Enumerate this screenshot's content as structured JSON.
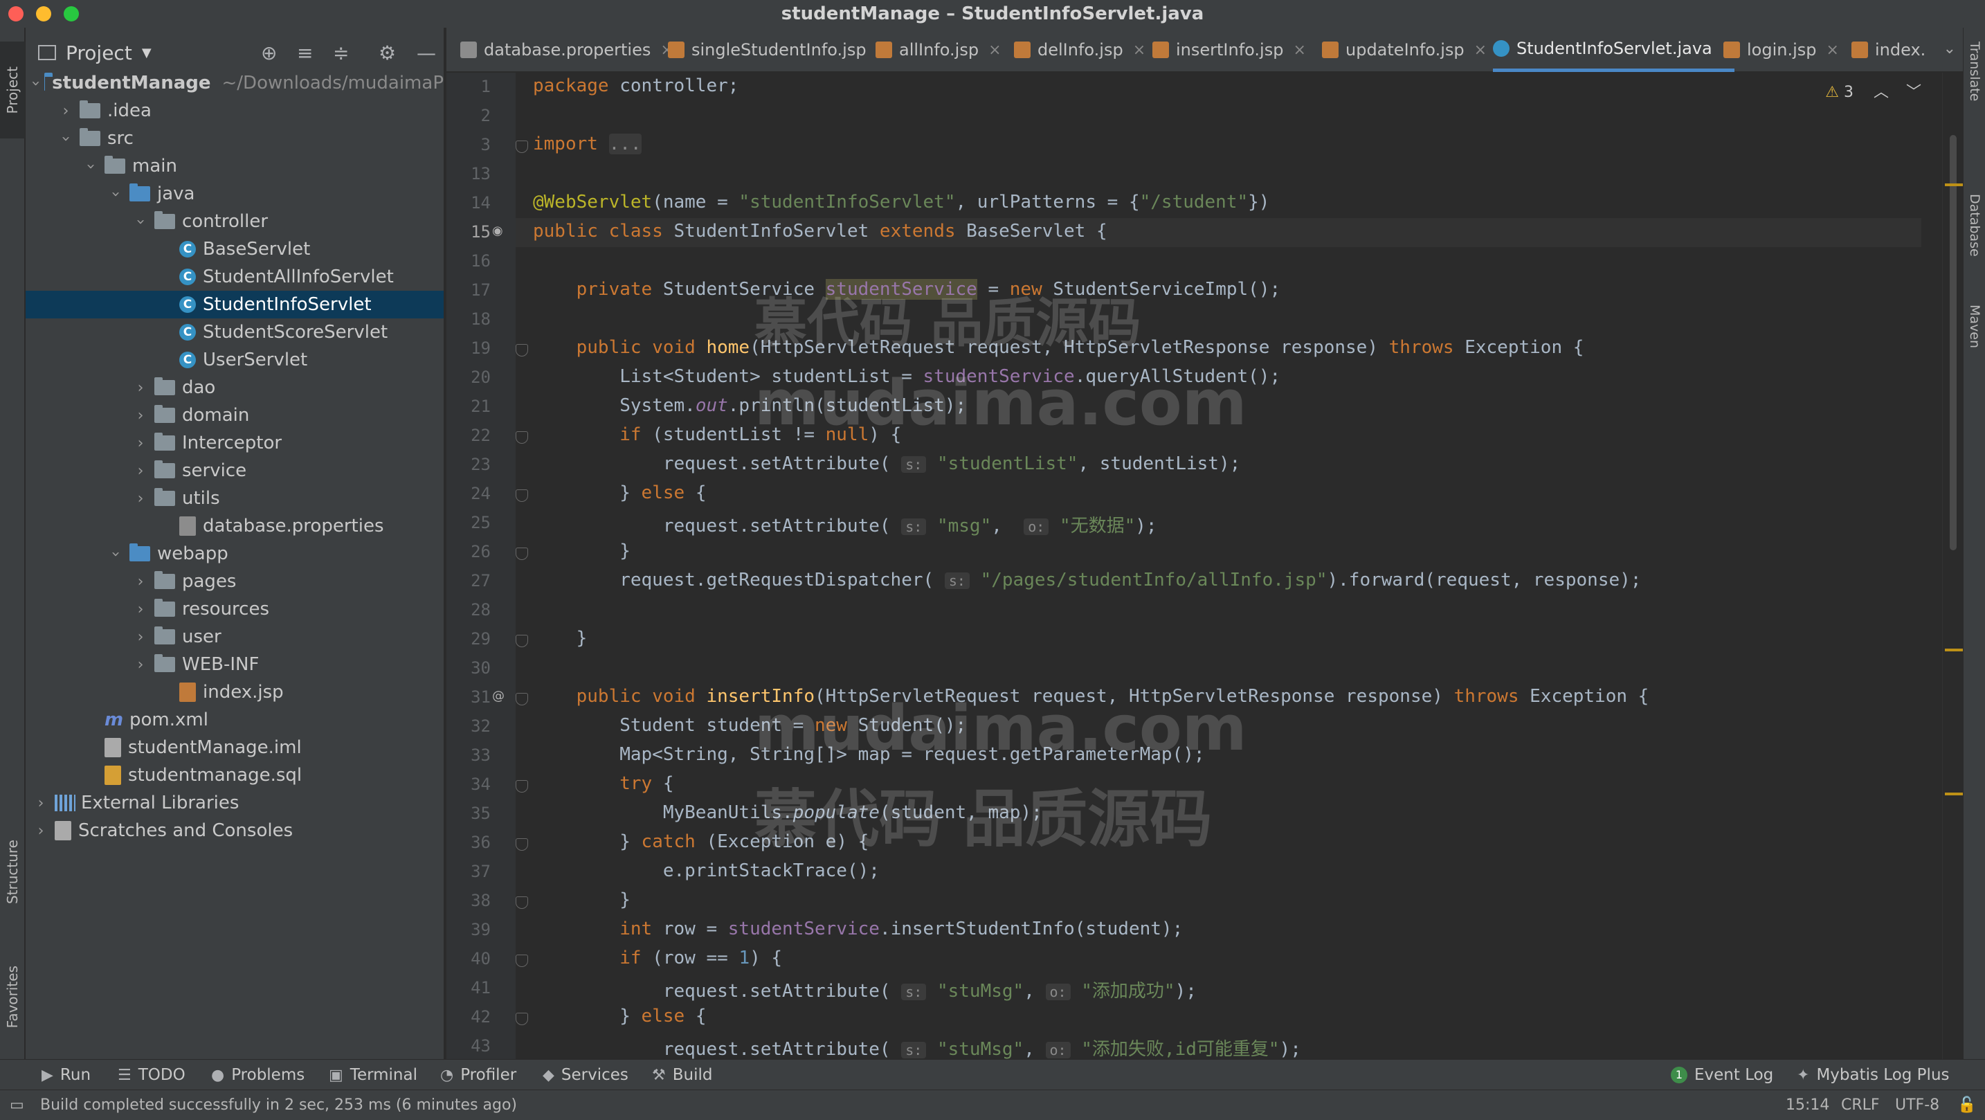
{
  "window": {
    "title": "studentManage – StudentInfoServlet.java",
    "traffic_colors": [
      "#fe5f57",
      "#febc2e",
      "#28c840"
    ]
  },
  "left_strip": {
    "project_label": "Project",
    "structure_label": "Structure",
    "favorites_label": "Favorites"
  },
  "right_strip": {
    "translate_label": "Translate",
    "database_label": "Database",
    "maven_label": "Maven"
  },
  "project_panel": {
    "title": "Project",
    "tree": [
      {
        "label": "studentManage",
        "extra": "~/Downloads/mudaimaP",
        "depth": 0,
        "expanded": true,
        "icon": "module-folder-icon",
        "bold": true
      },
      {
        "label": ".idea",
        "depth": 1,
        "expanded": false,
        "icon": "folder-icon"
      },
      {
        "label": "src",
        "depth": 1,
        "expanded": true,
        "icon": "folder-icon"
      },
      {
        "label": "main",
        "depth": 2,
        "expanded": true,
        "icon": "folder-icon"
      },
      {
        "label": "java",
        "depth": 3,
        "expanded": true,
        "icon": "source-folder-icon"
      },
      {
        "label": "controller",
        "depth": 4,
        "expanded": true,
        "icon": "package-icon"
      },
      {
        "label": "BaseServlet",
        "depth": 5,
        "icon": "class-icon"
      },
      {
        "label": "StudentAllInfoServlet",
        "depth": 5,
        "icon": "class-icon"
      },
      {
        "label": "StudentInfoServlet",
        "depth": 5,
        "icon": "class-icon",
        "selected": true
      },
      {
        "label": "StudentScoreServlet",
        "depth": 5,
        "icon": "class-icon"
      },
      {
        "label": "UserServlet",
        "depth": 5,
        "icon": "class-icon"
      },
      {
        "label": "dao",
        "depth": 4,
        "expanded": false,
        "icon": "package-icon"
      },
      {
        "label": "domain",
        "depth": 4,
        "expanded": false,
        "icon": "package-icon"
      },
      {
        "label": "Interceptor",
        "depth": 4,
        "expanded": false,
        "icon": "package-icon"
      },
      {
        "label": "service",
        "depth": 4,
        "expanded": false,
        "icon": "package-icon"
      },
      {
        "label": "utils",
        "depth": 4,
        "expanded": false,
        "icon": "package-icon"
      },
      {
        "label": "database.properties",
        "depth": 5,
        "icon": "properties-file-icon"
      },
      {
        "label": "webapp",
        "depth": 3,
        "expanded": true,
        "icon": "web-folder-icon"
      },
      {
        "label": "pages",
        "depth": 4,
        "expanded": false,
        "icon": "folder-icon"
      },
      {
        "label": "resources",
        "depth": 4,
        "expanded": false,
        "icon": "folder-icon"
      },
      {
        "label": "user",
        "depth": 4,
        "expanded": false,
        "icon": "folder-icon"
      },
      {
        "label": "WEB-INF",
        "depth": 4,
        "expanded": false,
        "icon": "folder-icon"
      },
      {
        "label": "index.jsp",
        "depth": 5,
        "icon": "jsp-file-icon"
      },
      {
        "label": "pom.xml",
        "depth": 2,
        "icon": "maven-icon"
      },
      {
        "label": "studentManage.iml",
        "depth": 2,
        "icon": "iml-file-icon"
      },
      {
        "label": "studentmanage.sql",
        "depth": 2,
        "icon": "sql-file-icon"
      },
      {
        "label": "External Libraries",
        "depth": 0,
        "expanded": false,
        "icon": "library-icon"
      },
      {
        "label": "Scratches and Consoles",
        "depth": 0,
        "expanded": false,
        "icon": "scratches-icon"
      }
    ]
  },
  "tabs": [
    {
      "label": "database.properties",
      "icon": "properties-file-icon"
    },
    {
      "label": "singleStudentInfo.jsp",
      "icon": "jsp-file-icon"
    },
    {
      "label": "allInfo.jsp",
      "icon": "jsp-file-icon"
    },
    {
      "label": "delInfo.jsp",
      "icon": "jsp-file-icon"
    },
    {
      "label": "insertInfo.jsp",
      "icon": "jsp-file-icon"
    },
    {
      "label": "updateInfo.jsp",
      "icon": "jsp-file-icon"
    },
    {
      "label": "StudentInfoServlet.java",
      "icon": "class-icon",
      "active": true
    },
    {
      "label": "login.jsp",
      "icon": "jsp-file-icon"
    },
    {
      "label": "index.",
      "icon": "jsp-file-icon"
    }
  ],
  "editor": {
    "warning_count": "3",
    "current_line": "15",
    "lines": [
      {
        "n": "1",
        "html": "<span class='kw'>package</span> controller;"
      },
      {
        "n": "2",
        "html": ""
      },
      {
        "n": "3",
        "html": "<span class='kw'>import</span> <span class='fold'>...</span>"
      },
      {
        "n": "13",
        "html": ""
      },
      {
        "n": "14",
        "html": "<span class='ann'>@WebServlet</span>(name = <span class='str'>\"studentInfoServlet\"</span>, urlPatterns = {<span class='str'>\"/student\"</span>})"
      },
      {
        "n": "15",
        "html": "<span class='kw'>public class</span> StudentInfoServlet <span class='kw'>extends</span> BaseServlet {"
      },
      {
        "n": "16",
        "html": ""
      },
      {
        "n": "17",
        "html": "    <span class='kw'>private</span> StudentService <span class='fld hl'>studentService</span> = <span class='kw'>new</span> StudentServiceImpl();"
      },
      {
        "n": "18",
        "html": ""
      },
      {
        "n": "19",
        "html": "    <span class='kw'>public void</span> <span class='fn'>home</span>(HttpServletRequest request, HttpServletResponse response) <span class='kw'>throws</span> Exception {"
      },
      {
        "n": "20",
        "html": "        List&lt;Student&gt; studentList = <span class='fld'>studentService</span>.queryAllStudent();"
      },
      {
        "n": "21",
        "html": "        System.<span class='fld italic'>out</span>.println(studentList);"
      },
      {
        "n": "22",
        "html": "        <span class='kw'>if</span> (studentList != <span class='kw'>null</span>) {"
      },
      {
        "n": "23",
        "html": "            request.setAttribute( <span class='hint'>s:</span> <span class='str'>\"studentList\"</span>, studentList);"
      },
      {
        "n": "24",
        "html": "        } <span class='kw'>else</span> {"
      },
      {
        "n": "25",
        "html": "            request.setAttribute( <span class='hint'>s:</span> <span class='str'>\"msg\"</span>,  <span class='hint'>o:</span> <span class='str'>\"无数据\"</span>);"
      },
      {
        "n": "26",
        "html": "        }"
      },
      {
        "n": "27",
        "html": "        request.getRequestDispatcher( <span class='hint'>s:</span> <span class='str'>\"/pages/studentInfo/allInfo.jsp\"</span>).forward(request, response);"
      },
      {
        "n": "28",
        "html": ""
      },
      {
        "n": "29",
        "html": "    }"
      },
      {
        "n": "30",
        "html": ""
      },
      {
        "n": "31",
        "html": "    <span class='kw'>public void</span> <span class='fn'>insertInfo</span>(HttpServletRequest request, HttpServletResponse response) <span class='kw'>throws</span> Exception {"
      },
      {
        "n": "32",
        "html": "        Student student = <span class='kw'>new</span> Student();"
      },
      {
        "n": "33",
        "html": "        Map&lt;String, String[]&gt; map = request.getParameterMap();"
      },
      {
        "n": "34",
        "html": "        <span class='kw'>try</span> {"
      },
      {
        "n": "35",
        "html": "            MyBeanUtils.<span class='italic'>populate</span>(student, map);"
      },
      {
        "n": "36",
        "html": "        } <span class='kw'>catch</span> (Exception e) {"
      },
      {
        "n": "37",
        "html": "            e.printStackTrace();"
      },
      {
        "n": "38",
        "html": "        }"
      },
      {
        "n": "39",
        "html": "        <span class='kw'>int</span> row = <span class='fld'>studentService</span>.insertStudentInfo(student);"
      },
      {
        "n": "40",
        "html": "        <span class='kw'>if</span> (row == <span class='num'>1</span>) {"
      },
      {
        "n": "41",
        "html": "            request.setAttribute( <span class='hint'>s:</span> <span class='str'>\"stuMsg\"</span>, <span class='hint'>o:</span> <span class='str'>\"添加成功\"</span>);"
      },
      {
        "n": "42",
        "html": "        } <span class='kw'>else</span> {"
      },
      {
        "n": "43",
        "html": "            request.setAttribute( <span class='hint'>s:</span> <span class='str'>\"stuMsg\"</span>, <span class='hint'>o:</span> <span class='str'>\"添加失败,id可能重复\"</span>);"
      }
    ]
  },
  "watermark": {
    "cn": "慕代码 品质源码",
    "en": "mudaima.com"
  },
  "bottom_tools": [
    {
      "label": "Run",
      "icon": "run-icon"
    },
    {
      "label": "TODO",
      "icon": "todo-icon"
    },
    {
      "label": "Problems",
      "icon": "problems-icon"
    },
    {
      "label": "Terminal",
      "icon": "terminal-icon"
    },
    {
      "label": "Profiler",
      "icon": "profiler-icon"
    },
    {
      "label": "Services",
      "icon": "services-icon"
    },
    {
      "label": "Build",
      "icon": "build-icon"
    }
  ],
  "bottom_right_tools": [
    {
      "label": "Event Log",
      "badge": "1",
      "icon": "event-log-icon"
    },
    {
      "label": "Mybatis Log Plus",
      "icon": "mybatis-icon"
    }
  ],
  "status": {
    "message": "Build completed successfully in 2 sec, 253 ms (6 minutes ago)",
    "position": "15:14",
    "line_ending": "CRLF",
    "encoding": "UTF-8"
  }
}
